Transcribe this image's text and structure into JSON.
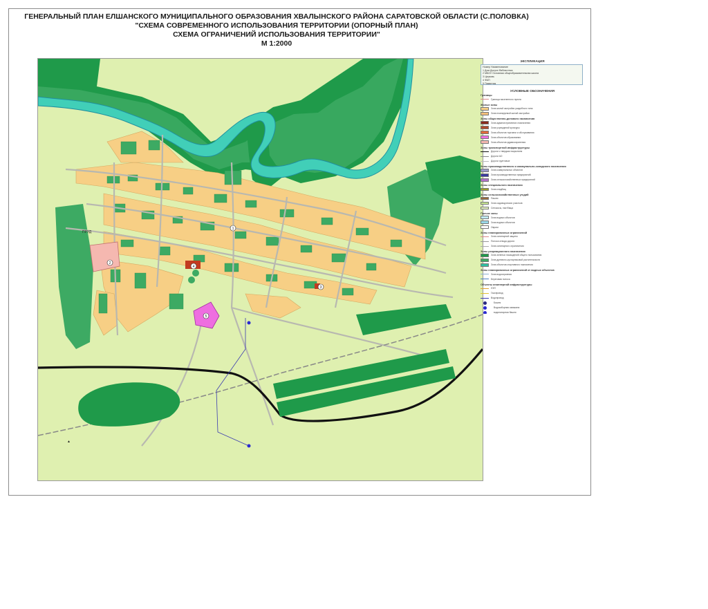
{
  "title": {
    "line1": "ГЕНЕРАЛЬНЫЙ ПЛАН ЕЛШАНСКОГО МУНИЦИПАЛЬНОГО ОБРАЗОВАНИЯ  ХВАЛЫНСКОГО РАЙОНА САРАТОВСКОЙ ОБЛАСТИ (С.ПОЛОВКА)",
    "line2": "\"СХЕМА СОВРЕМЕННОГО ИСПОЛЬЗОВАНИЯ ТЕРРИТОРИИ (ОПОРНЫЙ ПЛАН)",
    "line3": "СХЕМА ОГРАНИЧЕНИЙ ИСПОЛЬЗОВАНИЯ ТЕРРИТОРИИ\"",
    "scale": "М 1:2000"
  },
  "colors": {
    "background": "#dff0b0",
    "residential": "#f7cf85",
    "garden": "#3daa63",
    "forest": "#1f9a4a",
    "river": "#41cfb8",
    "river_outline": "#1f8fa0",
    "school": "#f5b8b0",
    "culture": "#ee6ee0",
    "admin": "#c23a1f",
    "road": "#b8b8b0",
    "railway": "#111111"
  },
  "map": {
    "label_prud": "ПРУД",
    "markers": [
      "1",
      "2",
      "3",
      "4",
      "5"
    ]
  },
  "legend": {
    "explication_title": "ЭКСПЛИКАЦИЯ",
    "explication_header": "Номер   Наименование",
    "explication_rows": [
      "1  Дом Досуга /библиотека",
      "2  МБОУ Основная общеобразовательная школа",
      "3  Церковь",
      "4  ФАП",
      "5  Памятник"
    ],
    "conventions_title": "УСЛОВНЫЕ ОБОЗНАЧЕНИЯ",
    "sections": [
      {
        "title": "Границы",
        "items": [
          {
            "label": "Граница населенного пункта",
            "kind": "line",
            "color": "#d98a8a"
          }
        ]
      },
      {
        "title": "Жилые зоны",
        "items": [
          {
            "label": "Зона жилой застройки усадебного типа",
            "kind": "box",
            "color": "#f7cf85"
          },
          {
            "label": "Зона планируемой жилой застройки",
            "kind": "box",
            "color": "#f3bf7a"
          }
        ]
      },
      {
        "title": "Зоны общественно-делового назначения",
        "items": [
          {
            "label": "Зона административного назначения",
            "kind": "box",
            "color": "#8a2a1a"
          },
          {
            "label": "Зона учреждений культуры",
            "kind": "box",
            "color": "#b04a2a"
          },
          {
            "label": "Зона объектов торговли и обслуживания",
            "kind": "box",
            "color": "#e06a3a"
          },
          {
            "label": "Зона объектов образования",
            "kind": "box",
            "color": "#ee6ee0"
          },
          {
            "label": "Зона объектов здравоохранения",
            "kind": "box",
            "color": "#f5b8b0"
          }
        ]
      },
      {
        "title": "Зоны транспортной инфраструктуры",
        "items": [
          {
            "label": "Дороги с твердым покрытием",
            "kind": "line",
            "color": "#111111"
          },
          {
            "label": "Дороги АО",
            "kind": "line",
            "color": "#888888"
          },
          {
            "label": "Дороги грунтовые",
            "kind": "line",
            "color": "#bbbbbb"
          }
        ]
      },
      {
        "title": "Зоны производственного и коммунально-складского назначения",
        "items": [
          {
            "label": "Зона коммунальных объектов",
            "kind": "box",
            "color": "#9a9ac8"
          },
          {
            "label": "Зона производственных предприятий",
            "kind": "box",
            "color": "#3a3aa0"
          },
          {
            "label": "Зона сельскохозяйственных предприятий",
            "kind": "box",
            "color": "#b070c8"
          }
        ]
      },
      {
        "title": "Зоны специального назначения",
        "items": [
          {
            "label": "Зона кладбищ",
            "kind": "box",
            "color": "#a0a030"
          }
        ]
      },
      {
        "title": "Зоны сельскохозяйственных угодий",
        "items": [
          {
            "label": "Пашни",
            "kind": "box",
            "color": "#9a6a3a"
          },
          {
            "label": "Зона садоводческих участков",
            "kind": "box",
            "color": "#c8e890"
          },
          {
            "label": "Сенокосы, пастбища",
            "kind": "box",
            "color": "#e4f2c0"
          }
        ]
      },
      {
        "title": "Прочие зоны",
        "items": [
          {
            "label": "Зона водных объектов",
            "kind": "box",
            "color": "#bfe8f0"
          },
          {
            "label": "Зона водных объектов",
            "kind": "box",
            "color": "#9ad8e8"
          },
          {
            "label": "Овраги",
            "kind": "box",
            "color": "#ffffff"
          }
        ]
      },
      {
        "title": "Зоны планировочных ограничений",
        "items": [
          {
            "label": "Зона санитарной защиты",
            "kind": "line",
            "color": "#d98a8a"
          },
          {
            "label": "Полоса отвода дороги",
            "kind": "line",
            "color": "#999999"
          },
          {
            "label": "Зона санитарного ограничения",
            "kind": "line",
            "color": "#aaaaaa"
          }
        ]
      },
      {
        "title": "Зоны рекреационного назначения",
        "items": [
          {
            "label": "Зона зеленых насаждений общего пользования",
            "kind": "box",
            "color": "#1f9a4a"
          },
          {
            "label": "Зона древесно-кустарниковой растительности",
            "kind": "box",
            "color": "#3daa63"
          },
          {
            "label": "Зона объектов спортивного назначения",
            "kind": "box",
            "color": "#30c0a0"
          }
        ]
      },
      {
        "title": "Зоны планировочных ограничений от водных объектов",
        "items": [
          {
            "label": "Зона водоохранная",
            "kind": "line",
            "color": "#8ab0d0"
          },
          {
            "label": "Береговая полоса",
            "kind": "line",
            "color": "#4a80c0"
          }
        ]
      },
      {
        "title": "Объекты инженерной инфраструктуры",
        "items": [
          {
            "label": "ЛЭП",
            "kind": "line",
            "color": "#e0a030"
          },
          {
            "label": "Газопровод",
            "kind": "line",
            "color": "#e0c030"
          },
          {
            "label": "Водопровод",
            "kind": "line",
            "color": "#3a3ab0"
          },
          {
            "label": "Башня",
            "kind": "dot",
            "color": "#2a2a80"
          },
          {
            "label": "Водозаборная скважина",
            "kind": "dot",
            "color": "#2a2ad0"
          },
          {
            "label": "водонапорная башня",
            "kind": "dot",
            "color": "#2a2ad0"
          }
        ]
      }
    ]
  }
}
